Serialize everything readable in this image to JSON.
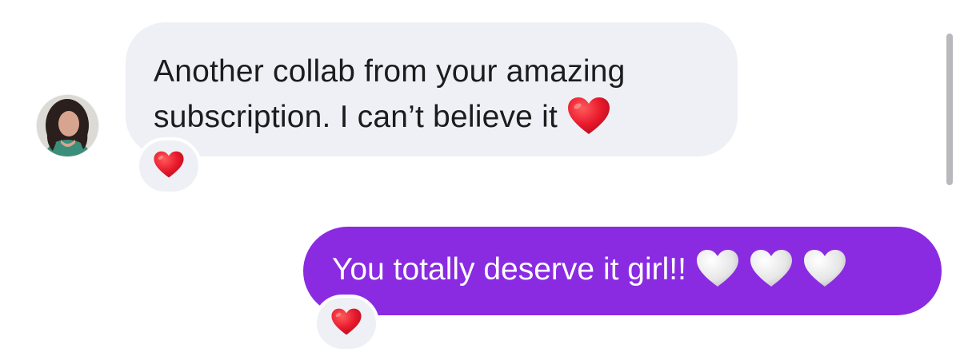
{
  "conversation": {
    "incoming": {
      "text": "Another collab from your amazing subscription. I can’t believe it",
      "trailing_emoji": "red-heart",
      "reaction": "red-heart"
    },
    "outgoing": {
      "text": "You totally deserve it girl!!",
      "trailing_emojis": [
        "white-heart",
        "white-heart",
        "white-heart"
      ],
      "reaction": "red-heart"
    }
  },
  "colors": {
    "incoming_bubble": "#eef0f5",
    "outgoing_bubble": "#8a2be2",
    "red_heart": "#e8192c",
    "white_heart": "#e6e6e6"
  }
}
